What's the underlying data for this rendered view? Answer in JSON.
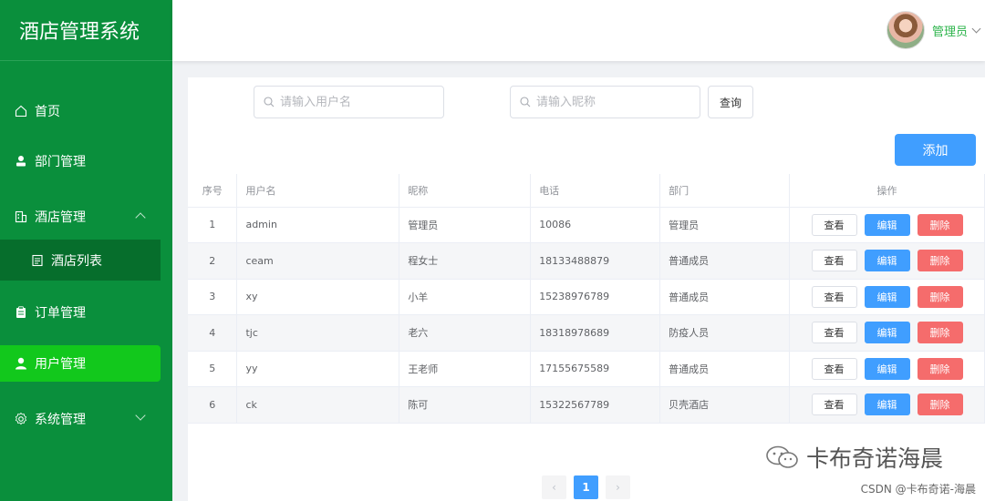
{
  "app": {
    "title": "酒店管理系统"
  },
  "sidebar": {
    "items": [
      {
        "label": "首页",
        "icon": "home-icon"
      },
      {
        "label": "部门管理",
        "icon": "person-icon"
      },
      {
        "label": "酒店管理",
        "icon": "building-icon",
        "expanded": true
      },
      {
        "label": "酒店列表",
        "icon": "document-icon"
      },
      {
        "label": "订单管理",
        "icon": "clipboard-icon"
      },
      {
        "label": "用户管理",
        "icon": "user-icon",
        "active": true
      },
      {
        "label": "系统管理",
        "icon": "gear-icon"
      }
    ]
  },
  "header": {
    "user_name": "管理员"
  },
  "search": {
    "username_placeholder": "请输入用户名",
    "nickname_placeholder": "请输入昵称",
    "query_label": "查询"
  },
  "toolbar": {
    "add_label": "添加"
  },
  "table": {
    "headers": [
      "序号",
      "用户名",
      "昵称",
      "电话",
      "部门",
      "操作"
    ],
    "rows": [
      {
        "no": "1",
        "username": "admin",
        "nickname": "管理员",
        "phone": "10086",
        "dept": "管理员"
      },
      {
        "no": "2",
        "username": "ceam",
        "nickname": "程女士",
        "phone": "18133488879",
        "dept": "普通成员"
      },
      {
        "no": "3",
        "username": "xy",
        "nickname": "小羊",
        "phone": "15238976789",
        "dept": "普通成员"
      },
      {
        "no": "4",
        "username": "tjc",
        "nickname": "老六",
        "phone": "18318978689",
        "dept": "防疫人员"
      },
      {
        "no": "5",
        "username": "yy",
        "nickname": "王老师",
        "phone": "17155675589",
        "dept": "普通成员"
      },
      {
        "no": "6",
        "username": "ck",
        "nickname": "陈可",
        "phone": "15322567789",
        "dept": "贝壳酒店"
      }
    ],
    "actions": {
      "view": "查看",
      "edit": "编辑",
      "delete": "删除"
    }
  },
  "pagination": {
    "current": "1",
    "prev": "‹",
    "next": "›"
  },
  "watermark": {
    "text": "卡布奇诺海晨",
    "csdn": "CSDN @卡布奇诺-海晨"
  },
  "colors": {
    "sidebar": "#0a8f3c",
    "active": "#12c81c",
    "primary": "#409eff",
    "danger": "#f56c6c"
  }
}
